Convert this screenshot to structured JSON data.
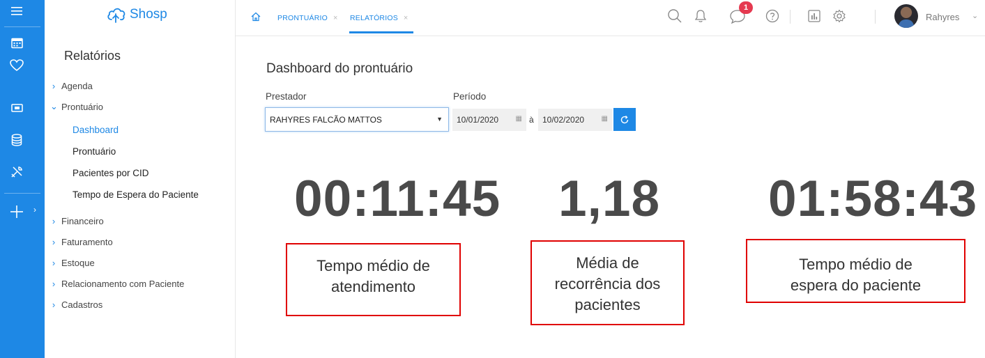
{
  "app": {
    "logo_text": "Shosp"
  },
  "rail": {
    "icons": [
      "menu-icon",
      "calendar-icon",
      "heart-icon",
      "money-icon",
      "database-icon",
      "tools-icon",
      "plus-icon"
    ]
  },
  "sidebar": {
    "title": "Relatórios",
    "menu": [
      {
        "label": "Agenda"
      },
      {
        "label": "Prontuário"
      },
      {
        "label": "Financeiro"
      },
      {
        "label": "Faturamento"
      },
      {
        "label": "Estoque"
      },
      {
        "label": "Relacionamento com Paciente"
      },
      {
        "label": "Cadastros"
      }
    ],
    "subitems": [
      {
        "label": "Dashboard"
      },
      {
        "label": "Prontuário"
      },
      {
        "label": "Pacientes por CID"
      },
      {
        "label": "Tempo de Espera do Paciente"
      }
    ]
  },
  "topbar": {
    "tabs": [
      {
        "label": "PRONTUÁRIO",
        "close": "×"
      },
      {
        "label": "RELATÓRIOS",
        "close": "×"
      }
    ],
    "notification_badge": "1",
    "user_name": "Rahyres"
  },
  "main": {
    "title": "Dashboard do prontuário",
    "filters": {
      "provider_label": "Prestador",
      "provider_value": "RAHYRES FALCÃO MATTOS",
      "period_label": "Período",
      "date_from": "10/01/2020",
      "date_sep": "à",
      "date_to": "10/02/2020"
    },
    "kpis": [
      {
        "value": "00:11:45",
        "label_l1": "Tempo médio de",
        "label_l2": "atendimento"
      },
      {
        "value": "1,18",
        "label_l1": "Média de",
        "label_l2": "recorrência dos",
        "label_l3": "pacientes"
      },
      {
        "value": "01:58:43",
        "label_l1": "Tempo médio de",
        "label_l2": "espera do paciente"
      }
    ]
  },
  "colors": {
    "accent": "#1e88e5",
    "highlight_box": "#e00000",
    "badge": "#e53950"
  }
}
